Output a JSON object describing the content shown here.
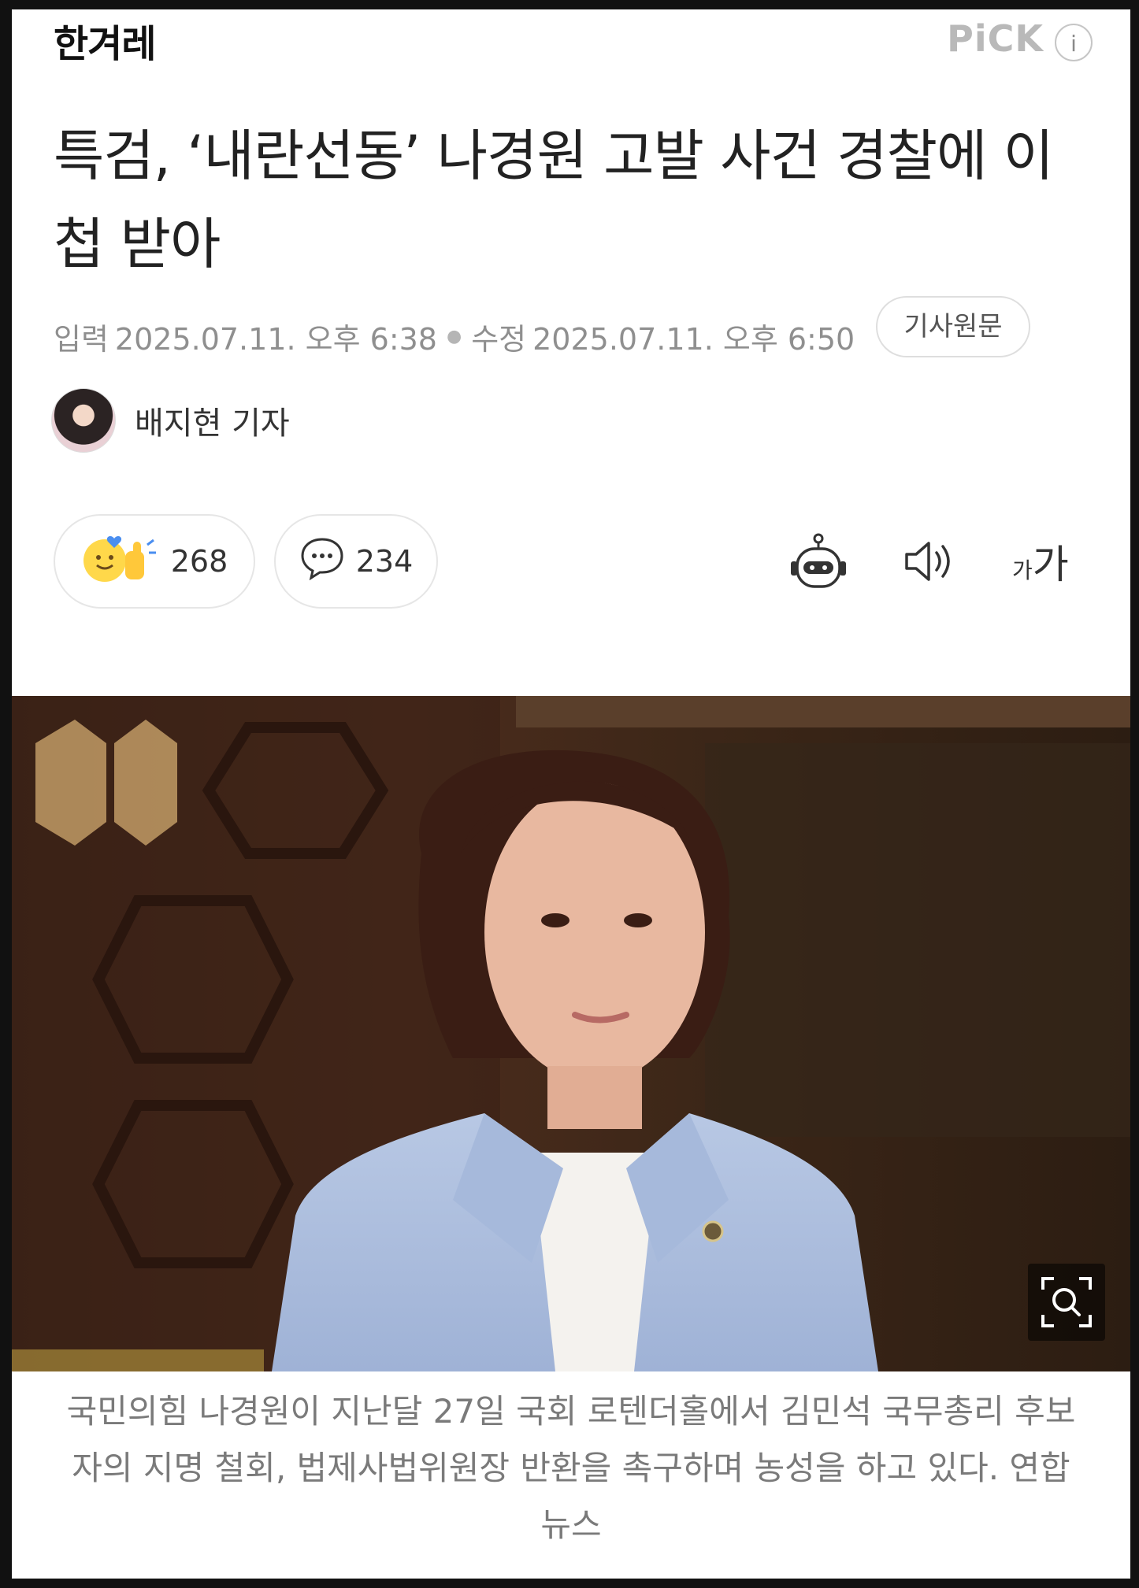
{
  "header": {
    "logo_text": "한겨레",
    "pick_label": "PiCK",
    "info_icon_label": "i"
  },
  "article": {
    "headline": "특검, ‘내란선동’ 나경원 고발 사건 경찰에 이첩 받아",
    "meta": {
      "input_label": "입력",
      "input_time": "2025.07.11. 오후 6:38",
      "modified_label": "수정",
      "modified_time": "2025.07.11. 오후 6:50",
      "original_button": "기사원문"
    },
    "reporter": {
      "name": "배지현 기자"
    },
    "actions": {
      "reaction_count": "268",
      "comment_count": "234",
      "font_small": "가",
      "font_big": "가"
    },
    "photo": {
      "caption": "국민의힘 나경원이 지난달 27일 국회 로텐더홀에서 김민석 국무총리 후보자의 지명 철회, 법제사법위원장 반환을 촉구하며 농성을 하고 있다. 연합뉴스"
    }
  },
  "icons": {
    "info": "info-icon",
    "reaction": "reaction-emoji-icon",
    "comment": "speech-bubble-icon",
    "summary_bot": "robot-icon",
    "tts": "speaker-icon",
    "zoom": "zoom-search-icon"
  },
  "colors": {
    "background": "#ffffff",
    "frame": "#111111",
    "headline": "#222222",
    "meta": "#8f8f8f",
    "caption": "#7a7a7a",
    "pick": "#b9b9b9"
  }
}
